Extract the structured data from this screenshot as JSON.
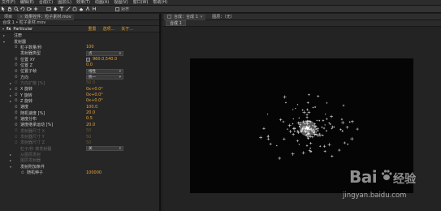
{
  "menu": [
    "文件(F)",
    "编辑(E)",
    "合成(C)",
    "图层(L)",
    "效果(T)",
    "动画(A)",
    "视图(V)",
    "窗口(W)",
    "帮助(H)"
  ],
  "toolbar": {
    "snap_label": "对齐",
    "tools": [
      "selection-icon",
      "hand-icon",
      "zoom-icon",
      "rotate-icon",
      "camera-icon",
      "pan-behind-icon",
      "rect-mask-icon",
      "pen-icon",
      "text-icon",
      "brush-icon",
      "clone-icon",
      "eraser-icon",
      "roto-icon",
      "puppet-icon"
    ]
  },
  "left": {
    "tabs": [
      {
        "label": "项目",
        "active": false
      },
      {
        "label": "效果控件：粒子素材.mov",
        "active": true
      }
    ],
    "crumb": "合成 1 • 粒子素材.mov",
    "effect": {
      "fx": "fx",
      "name": "Particular",
      "reset": "重置",
      "options": "选项...",
      "about": "关于..."
    },
    "properties": [
      {
        "indent": 0,
        "tri": "▸",
        "label": "注册",
        "dim": false
      },
      {
        "indent": 0,
        "tri": "▾",
        "label": "发射器",
        "dim": false
      },
      {
        "indent": 1,
        "label": "粒子数量/秒",
        "value": "100",
        "sw": true
      },
      {
        "indent": 1,
        "label": "发射器类型",
        "dropdown": "点"
      },
      {
        "indent": 1,
        "label": "位置 XY",
        "point": "960.0,540.0",
        "sw": true
      },
      {
        "indent": 1,
        "label": "位置 Z",
        "value": "0.0",
        "sw": true
      },
      {
        "indent": 1,
        "label": "位置子帧",
        "dropdown": "线性",
        "sw": true
      },
      {
        "indent": 1,
        "label": "方向",
        "dropdown": "统一",
        "sw": true
      },
      {
        "indent": 1,
        "tri": "▸",
        "label": "方向扩散 [%]",
        "value": "50.0",
        "dim": true,
        "sw": true
      },
      {
        "indent": 1,
        "tri": "▸",
        "label": "X 旋转",
        "value": "0x+0.0°",
        "sw": true
      },
      {
        "indent": 1,
        "tri": "▸",
        "label": "Y 旋转",
        "value": "0x+0.0°",
        "sw": true
      },
      {
        "indent": 1,
        "tri": "▸",
        "label": "Z 旋转",
        "value": "0x+0.0°",
        "sw": true
      },
      {
        "indent": 1,
        "label": "速度",
        "value": "100.0",
        "sw": true
      },
      {
        "indent": 1,
        "label": "随机速度 [%]",
        "value": "20.0",
        "sw": true
      },
      {
        "indent": 1,
        "label": "速度分布",
        "value": "0.5",
        "sw": true
      },
      {
        "indent": 1,
        "label": "速度继承运动 [%]",
        "value": "20.0",
        "sw": true
      },
      {
        "indent": 1,
        "label": "发射器尺寸 X",
        "value": "50",
        "dim": true,
        "sw": true
      },
      {
        "indent": 1,
        "label": "发射器尺寸 Y",
        "value": "50",
        "dim": true,
        "sw": true
      },
      {
        "indent": 1,
        "label": "发射器尺寸 Z",
        "value": "50",
        "dim": true,
        "sw": true
      },
      {
        "indent": 1,
        "label": "粒子/秒 按发射器",
        "dropdown": "关",
        "dim": true
      },
      {
        "indent": 1,
        "tri": "▸",
        "label": "从图层发射",
        "dim": true
      },
      {
        "indent": 1,
        "tri": "▸",
        "label": "图层发射器",
        "dim": true
      },
      {
        "indent": 1,
        "tri": "▾",
        "label": "发射附加条件"
      },
      {
        "indent": 2,
        "label": "随机种子",
        "value": "100000",
        "sw": true
      }
    ]
  },
  "right": {
    "tabs": [
      {
        "label": "合成：合成 1",
        "active": true
      },
      {
        "label": "图层：（无）",
        "active": false
      }
    ],
    "subtab": "合成 1"
  },
  "watermark": {
    "brand": "Bai",
    "cn": "经验",
    "url": "jingyan.baidu.com"
  },
  "colors": {
    "value_orange": "#e8a23a",
    "link_orange": "#e0a030",
    "panel_bg": "#262626",
    "viewer_bg": "#050505"
  }
}
